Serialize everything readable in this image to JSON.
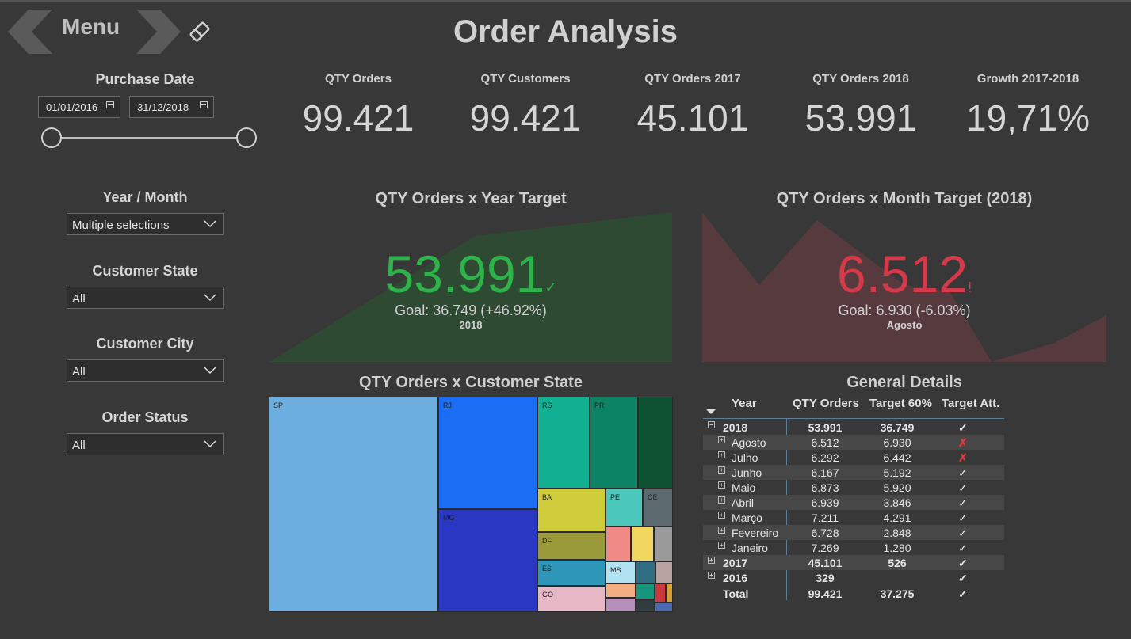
{
  "header": {
    "menu_label": "Menu",
    "title": "Order Analysis"
  },
  "filters": {
    "purchase_date": {
      "label": "Purchase Date",
      "start": "01/01/2016",
      "end": "31/12/2018"
    },
    "year_month": {
      "label": "Year / Month",
      "value": "Multiple selections"
    },
    "customer_state": {
      "label": "Customer State",
      "value": "All"
    },
    "customer_city": {
      "label": "Customer City",
      "value": "All"
    },
    "order_status": {
      "label": "Order Status",
      "value": "All"
    }
  },
  "kpis": [
    {
      "label": "QTY Orders",
      "value": "99.421"
    },
    {
      "label": "QTY Customers",
      "value": "99.421"
    },
    {
      "label": "QTY Orders 2017",
      "value": "45.101"
    },
    {
      "label": "QTY Orders 2018",
      "value": "53.991"
    },
    {
      "label": "Growth 2017-2018",
      "value": "19,71%"
    }
  ],
  "year_target": {
    "title": "QTY Orders x Year Target",
    "value": "53.991",
    "indicator": "✓",
    "goal": "Goal: 36.749 (+46.92%)",
    "period": "2018",
    "color": "#2eb34a"
  },
  "month_target": {
    "title": "QTY Orders x Month Target (2018)",
    "value": "6.512",
    "indicator": "!",
    "goal": "Goal: 6.930 (-6.03%)",
    "period": "Agosto",
    "color": "#d63a4a"
  },
  "state_chart": {
    "title": "QTY Orders x Customer State",
    "states": [
      "SP",
      "RJ",
      "RS",
      "PR",
      "MG",
      "BA",
      "PE",
      "CE",
      "DF",
      "ES",
      "MS",
      "GO"
    ]
  },
  "details": {
    "title": "General Details",
    "columns": [
      "Year",
      "QTY Orders",
      "Target 60%",
      "Target Att."
    ],
    "rows": [
      {
        "label": "2018",
        "qty": "53.991",
        "target": "36.749",
        "att": "✓"
      },
      {
        "label": "Agosto",
        "qty": "6.512",
        "target": "6.930",
        "att": "✗"
      },
      {
        "label": "Julho",
        "qty": "6.292",
        "target": "6.442",
        "att": "✗"
      },
      {
        "label": "Junho",
        "qty": "6.167",
        "target": "5.192",
        "att": "✓"
      },
      {
        "label": "Maio",
        "qty": "6.873",
        "target": "5.920",
        "att": "✓"
      },
      {
        "label": "Abril",
        "qty": "6.939",
        "target": "3.846",
        "att": "✓"
      },
      {
        "label": "Março",
        "qty": "7.211",
        "target": "4.291",
        "att": "✓"
      },
      {
        "label": "Fevereiro",
        "qty": "6.728",
        "target": "2.848",
        "att": "✓"
      },
      {
        "label": "Janeiro",
        "qty": "7.269",
        "target": "1.280",
        "att": "✓"
      },
      {
        "label": "2017",
        "qty": "45.101",
        "target": "526",
        "att": "✓"
      },
      {
        "label": "2016",
        "qty": "329",
        "target": "",
        "att": "✓"
      },
      {
        "label": "Total",
        "qty": "99.421",
        "target": "37.275",
        "att": "✓"
      }
    ]
  },
  "colors": {
    "background": "#383838",
    "good": "#2eb34a",
    "bad": "#d63a4a"
  }
}
